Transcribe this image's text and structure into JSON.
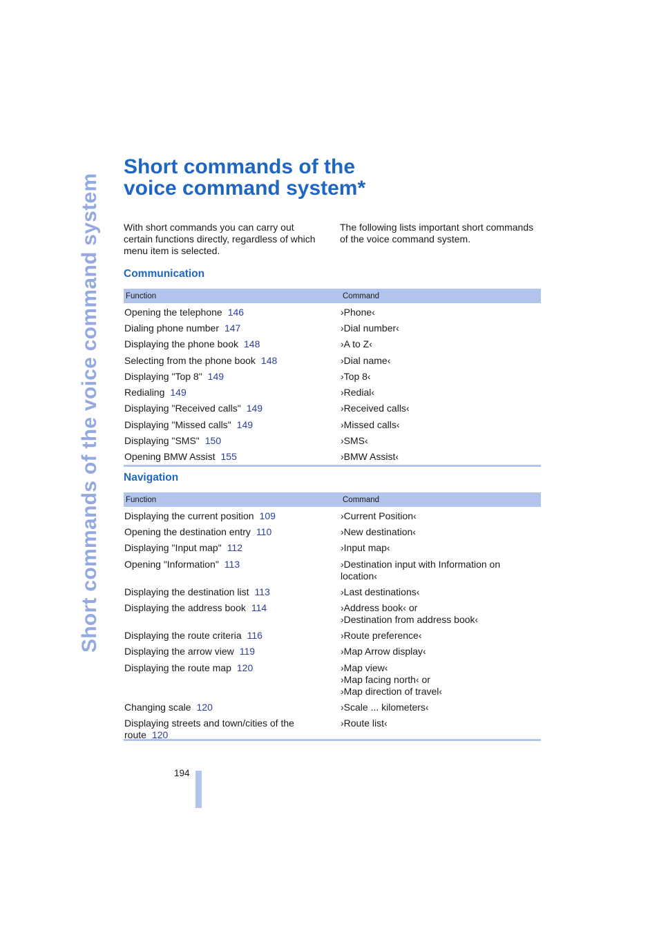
{
  "side_title": "Short commands of the voice command system",
  "title": {
    "line1": "Short commands of the",
    "line2": "voice command system*"
  },
  "intro": {
    "left": "With short commands you can carry out certain functions directly, regardless of which menu item is selected.",
    "right": "The following lists important short commands of the voice command system."
  },
  "communication": {
    "heading": "Communication",
    "col_function": "Function",
    "col_command": "Command",
    "rows": [
      {
        "function": "Opening the telephone",
        "page": "146",
        "command": "›Phone‹"
      },
      {
        "function": "Dialing phone number",
        "page": "147",
        "command": "›Dial number‹"
      },
      {
        "function": "Displaying the phone book",
        "page": "148",
        "command": "›A to Z‹"
      },
      {
        "function": "Selecting from the phone book",
        "page": "148",
        "command": "›Dial name‹"
      },
      {
        "function": "Displaying \"Top 8\"",
        "page": "149",
        "command": "›Top 8‹"
      },
      {
        "function": "Redialing",
        "page": "149",
        "command": "›Redial‹"
      },
      {
        "function": "Displaying \"Received calls\"",
        "page": "149",
        "command": "›Received calls‹"
      },
      {
        "function": "Displaying \"Missed calls\"",
        "page": "149",
        "command": "›Missed calls‹"
      },
      {
        "function": "Displaying \"SMS\"",
        "page": "150",
        "command": "›SMS‹"
      },
      {
        "function": "Opening BMW Assist",
        "page": "155",
        "command": "›BMW Assist‹"
      }
    ]
  },
  "navigation": {
    "heading": "Navigation",
    "col_function": "Function",
    "col_command": "Command",
    "rows": [
      {
        "function": "Displaying the current position",
        "page": "109",
        "command": [
          "›Current Position‹"
        ]
      },
      {
        "function": "Opening the destination entry",
        "page": "110",
        "command": [
          "›New destination‹"
        ]
      },
      {
        "function": "Displaying \"Input map\"",
        "page": "112",
        "command": [
          "›Input map‹"
        ]
      },
      {
        "function": "Opening \"Information\"",
        "page": "113",
        "command": [
          "›Destination input with Information on",
          "location‹"
        ]
      },
      {
        "function": "Displaying the destination list",
        "page": "113",
        "command": [
          "›Last destinations‹"
        ]
      },
      {
        "function": "Displaying the address book",
        "page": "114",
        "command": [
          "›Address book‹ or",
          "›Destination from address book‹"
        ]
      },
      {
        "function": "Displaying the route criteria",
        "page": "116",
        "command": [
          "›Route preference‹"
        ]
      },
      {
        "function": "Displaying the arrow view",
        "page": "119",
        "command": [
          "›Map Arrow display‹"
        ]
      },
      {
        "function": "Displaying the route map",
        "page": "120",
        "command": [
          "›Map view‹",
          "›Map facing north‹ or",
          "›Map direction of travel‹"
        ]
      },
      {
        "function": "Changing scale",
        "page": "120",
        "command": [
          "›Scale ... kilometers‹"
        ]
      },
      {
        "function": "Displaying streets and town/cities of the route",
        "page": "120",
        "command": [
          "›Route list‹"
        ]
      }
    ]
  },
  "page_number": "194"
}
